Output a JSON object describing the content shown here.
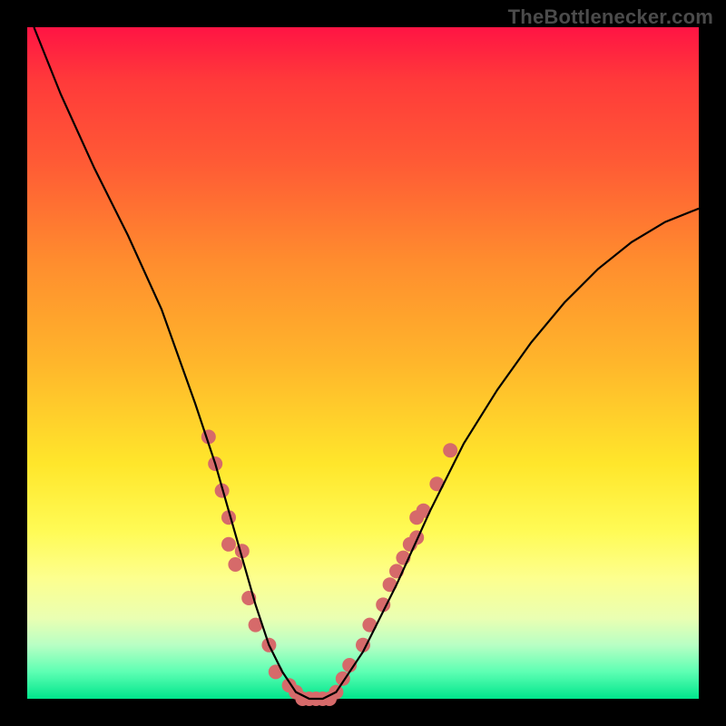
{
  "watermark": "TheBottlenecker.com",
  "chart_data": {
    "type": "line",
    "title": "",
    "xlabel": "",
    "ylabel": "",
    "xlim": [
      0,
      100
    ],
    "ylim": [
      0,
      100
    ],
    "grid": false,
    "legend": false,
    "series": [
      {
        "name": "curve",
        "color": "#000000",
        "x": [
          1,
          5,
          10,
          15,
          20,
          25,
          28,
          30,
          32,
          34,
          36,
          38,
          40,
          42,
          44,
          46,
          50,
          55,
          60,
          65,
          70,
          75,
          80,
          85,
          90,
          95,
          100
        ],
        "y": [
          100,
          90,
          79,
          69,
          58,
          44,
          35,
          28,
          21,
          14,
          8,
          4,
          1,
          0,
          0,
          1,
          7,
          17,
          28,
          38,
          46,
          53,
          59,
          64,
          68,
          71,
          73
        ]
      }
    ],
    "markers": [
      {
        "name": "dots",
        "color": "#d66a6a",
        "radius": 8,
        "points": [
          {
            "x": 27,
            "y": 39
          },
          {
            "x": 28,
            "y": 35
          },
          {
            "x": 29,
            "y": 31
          },
          {
            "x": 30,
            "y": 27
          },
          {
            "x": 30,
            "y": 23
          },
          {
            "x": 31,
            "y": 20
          },
          {
            "x": 32,
            "y": 22
          },
          {
            "x": 33,
            "y": 15
          },
          {
            "x": 34,
            "y": 11
          },
          {
            "x": 36,
            "y": 8
          },
          {
            "x": 37,
            "y": 4
          },
          {
            "x": 39,
            "y": 2
          },
          {
            "x": 40,
            "y": 1
          },
          {
            "x": 41,
            "y": 0
          },
          {
            "x": 42,
            "y": 0
          },
          {
            "x": 43,
            "y": 0
          },
          {
            "x": 44,
            "y": 0
          },
          {
            "x": 45,
            "y": 0
          },
          {
            "x": 46,
            "y": 1
          },
          {
            "x": 47,
            "y": 3
          },
          {
            "x": 48,
            "y": 5
          },
          {
            "x": 50,
            "y": 8
          },
          {
            "x": 51,
            "y": 11
          },
          {
            "x": 53,
            "y": 14
          },
          {
            "x": 54,
            "y": 17
          },
          {
            "x": 55,
            "y": 19
          },
          {
            "x": 56,
            "y": 21
          },
          {
            "x": 57,
            "y": 23
          },
          {
            "x": 58,
            "y": 27
          },
          {
            "x": 58,
            "y": 24
          },
          {
            "x": 59,
            "y": 28
          },
          {
            "x": 61,
            "y": 32
          },
          {
            "x": 63,
            "y": 37
          }
        ]
      }
    ]
  }
}
